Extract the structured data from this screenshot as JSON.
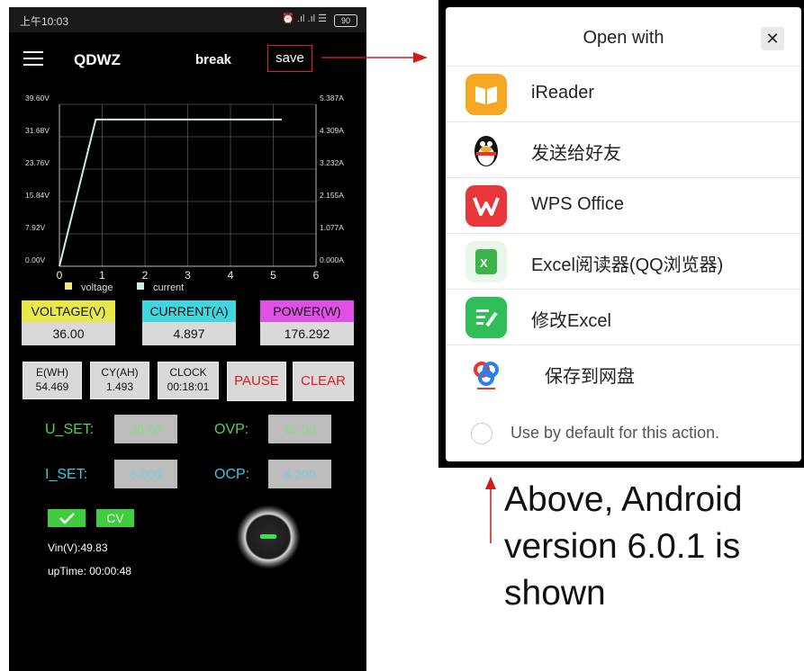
{
  "status_bar": {
    "time": "上午10:03",
    "signal": "⏰ .ıl .ıl ☰",
    "battery": "90"
  },
  "app": {
    "title": "QDWZ",
    "break_label": "break",
    "save_label": "save"
  },
  "chart_data": {
    "type": "line",
    "x_ticks": [
      "0",
      "1",
      "2",
      "3",
      "4",
      "5",
      "6"
    ],
    "xlim": [
      0,
      6
    ],
    "y_left_ticks": [
      "0.00V",
      "7.92V",
      "15.84V",
      "23.76V",
      "31.68V",
      "39.60V"
    ],
    "y_right_ticks": [
      "0.000A",
      "1.077A",
      "2.155A",
      "3.232A",
      "4.309A",
      "5.387A"
    ],
    "ylim_left": [
      0,
      39.6
    ],
    "grid": true,
    "legend_position": "bottom",
    "series": [
      {
        "name": "voltage",
        "color": "#f2ea7a",
        "x": [],
        "y": []
      },
      {
        "name": "current",
        "color": "#c8f0e8",
        "x": [
          0,
          0.85,
          5.2
        ],
        "y": [
          0,
          35.9,
          35.9
        ]
      }
    ]
  },
  "meters": {
    "voltage_label": "VOLTAGE(V)",
    "voltage_value": "36.00",
    "current_label": "CURRENT(A)",
    "current_value": "4.897",
    "power_label": "POWER(W)",
    "power_value": "176.292"
  },
  "counters": {
    "ewh_label": "E(WH)",
    "ewh_value": "54.469",
    "cyah_label": "CY(AH)",
    "cyah_value": "1.493",
    "clock_label": "CLOCK",
    "clock_value": "00:18:01",
    "pause_label": "PAUSE",
    "clear_label": "CLEAR"
  },
  "settings": {
    "u_set_label": "U_SET:",
    "u_set_value": "36.00",
    "ovp_label": "OVP:",
    "ovp_value": "62.00",
    "i_set_label": "I_SET:",
    "i_set_value": "6.000",
    "ocp_label": "OCP:",
    "ocp_value": "6.200"
  },
  "mode": {
    "check_icon": "check-icon",
    "cv_label": "CV"
  },
  "info": {
    "vin": "Vin(V):49.83",
    "uptime": "upTime:  00:00:48"
  },
  "dialog": {
    "title": "Open with",
    "close_label": "✕",
    "apps": [
      {
        "label": "iReader",
        "icon": "book-icon",
        "color": "#f5a623"
      },
      {
        "label": "发送给好友",
        "icon": "penguin-icon",
        "color": "#ffffff"
      },
      {
        "label": "WPS Office",
        "icon": "wps-icon",
        "color": "#e8373a"
      },
      {
        "label": "Excel阅读器(QQ浏览器)",
        "icon": "excel-icon",
        "color": "#3bb54a"
      },
      {
        "label": "修改Excel",
        "icon": "edit-icon",
        "color": "#2fbd57"
      },
      {
        "label": "保存到网盘",
        "icon": "cloud-icon",
        "color": "#ffffff"
      }
    ],
    "default_text": "Use by default for this action."
  },
  "annotation": {
    "text": "Above, Android version 6.0.1 is shown"
  }
}
